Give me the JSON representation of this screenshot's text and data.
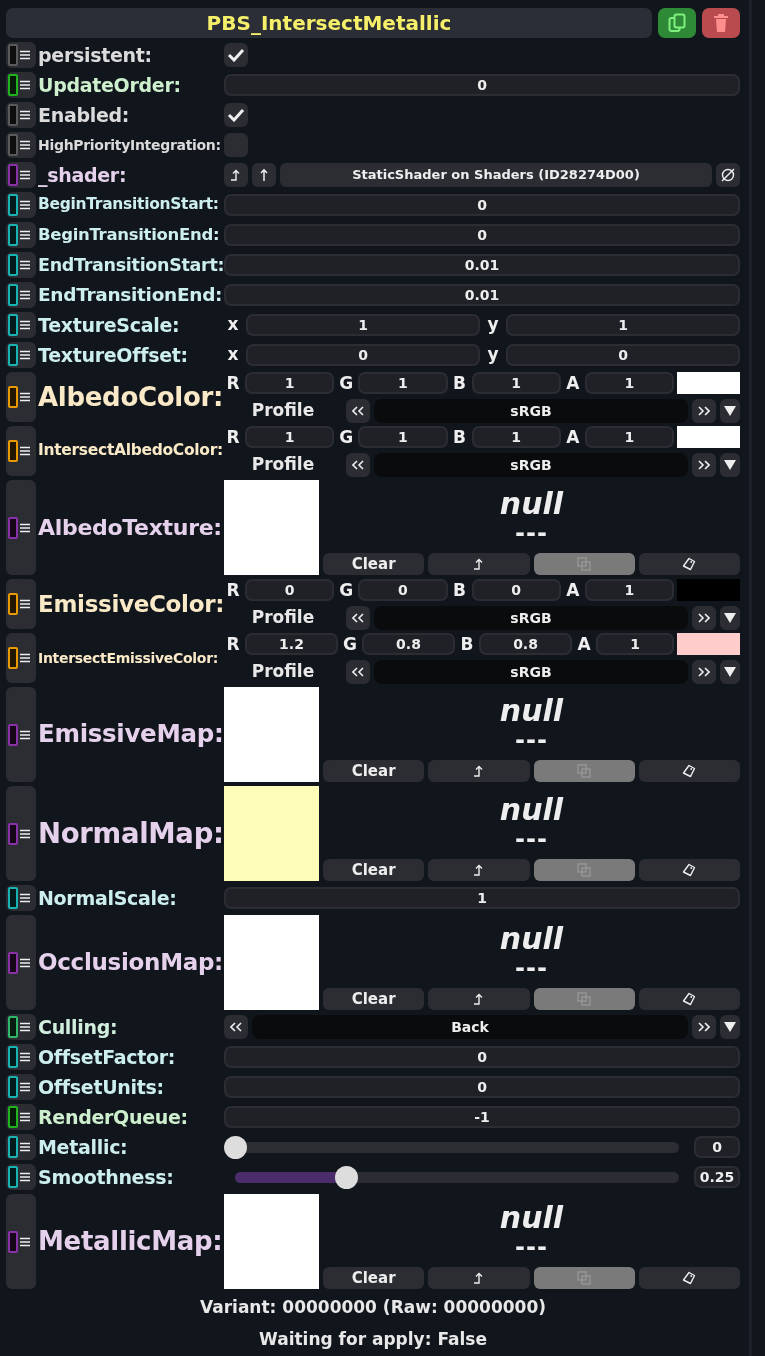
{
  "title": "PBS_IntersectMetallic",
  "fields": [
    {
      "kind": "checkbox",
      "label": "persistent:",
      "color": "#5a5a5a",
      "checked": true
    },
    {
      "kind": "number",
      "label": "UpdateOrder:",
      "color": "#1fb41f",
      "value": "0"
    },
    {
      "kind": "checkbox",
      "label": "Enabled:",
      "color": "#5a5a5a",
      "checked": true
    },
    {
      "kind": "checkbox",
      "label": "HighPriorityIntegration:",
      "color": "#5a5a5a",
      "checked": false
    },
    {
      "kind": "reference",
      "label": "_shader:",
      "color": "#8a30a8",
      "value": "StaticShader on Shaders (ID28274D00)"
    },
    {
      "kind": "number",
      "label": "BeginTransitionStart:",
      "color": "#19b3b3",
      "value": "0"
    },
    {
      "kind": "number",
      "label": "BeginTransitionEnd:",
      "color": "#19b3b3",
      "value": "0"
    },
    {
      "kind": "number",
      "label": "EndTransitionStart:",
      "color": "#19b3b3",
      "value": "0.01"
    },
    {
      "kind": "number",
      "label": "EndTransitionEnd:",
      "color": "#19b3b3",
      "value": "0.01"
    },
    {
      "kind": "vector",
      "label": "TextureScale:",
      "color": "#19b3b3",
      "components": [
        {
          "axis": "x",
          "value": "1"
        },
        {
          "axis": "y",
          "value": "1"
        }
      ]
    },
    {
      "kind": "vector",
      "label": "TextureOffset:",
      "color": "#19b3b3",
      "components": [
        {
          "axis": "x",
          "value": "0"
        },
        {
          "axis": "y",
          "value": "0"
        }
      ]
    },
    {
      "kind": "color",
      "label": "AlbedoColor:",
      "color": "#e89a00",
      "channels": [
        {
          "name": "R",
          "value": "1"
        },
        {
          "name": "G",
          "value": "1"
        },
        {
          "name": "B",
          "value": "1"
        },
        {
          "name": "A",
          "value": "1"
        }
      ],
      "swatch": {
        "color": "#ffffff"
      },
      "profile_label": "Profile",
      "profile": "sRGB"
    },
    {
      "kind": "color",
      "label": "IntersectAlbedoColor:",
      "color": "#e89a00",
      "channels": [
        {
          "name": "R",
          "value": "1"
        },
        {
          "name": "G",
          "value": "1"
        },
        {
          "name": "B",
          "value": "1"
        },
        {
          "name": "A",
          "value": "1"
        }
      ],
      "swatch": {
        "color": "#ffffff"
      },
      "profile_label": "Profile",
      "profile": "sRGB"
    },
    {
      "kind": "texture",
      "label": "AlbedoTexture:",
      "color": "#8a30a8",
      "preview": {
        "color": "#ffffff"
      },
      "value": "null",
      "detail": "---",
      "clear_label": "Clear",
      "copy_disabled": true
    },
    {
      "kind": "color",
      "label": "EmissiveColor:",
      "color": "#e89a00",
      "channels": [
        {
          "name": "R",
          "value": "0"
        },
        {
          "name": "G",
          "value": "0"
        },
        {
          "name": "B",
          "value": "0"
        },
        {
          "name": "A",
          "value": "1"
        }
      ],
      "swatch": {
        "color": "#000000"
      },
      "profile_label": "Profile",
      "profile": "sRGB"
    },
    {
      "kind": "color",
      "label": "IntersectEmissiveColor:",
      "color": "#e89a00",
      "channels": [
        {
          "name": "R",
          "value": "1.2"
        },
        {
          "name": "G",
          "value": "0.8"
        },
        {
          "name": "B",
          "value": "0.8"
        },
        {
          "name": "A",
          "value": "1"
        }
      ],
      "swatch": {
        "color": "#ffcccc"
      },
      "profile_label": "Profile",
      "profile": "sRGB"
    },
    {
      "kind": "texture",
      "label": "EmissiveMap:",
      "color": "#8a30a8",
      "preview": {
        "color": "#ffffff"
      },
      "value": "null",
      "detail": "---",
      "clear_label": "Clear",
      "copy_disabled": true
    },
    {
      "kind": "texture",
      "label": "NormalMap:",
      "color": "#8a30a8",
      "preview": {
        "color": "#fdfcb8"
      },
      "value": "null",
      "detail": "---",
      "clear_label": "Clear",
      "copy_disabled": true
    },
    {
      "kind": "number",
      "label": "NormalScale:",
      "color": "#19b3b3",
      "value": "1"
    },
    {
      "kind": "texture",
      "label": "OcclusionMap:",
      "color": "#8a30a8",
      "preview": {
        "color": "#ffffff"
      },
      "value": "null",
      "detail": "---",
      "clear_label": "Clear",
      "copy_disabled": true
    },
    {
      "kind": "enum",
      "label": "Culling:",
      "color": "#2fb86a",
      "value": "Back"
    },
    {
      "kind": "number",
      "label": "OffsetFactor:",
      "color": "#19b3b3",
      "value": "0"
    },
    {
      "kind": "number",
      "label": "OffsetUnits:",
      "color": "#19b3b3",
      "value": "0"
    },
    {
      "kind": "number",
      "label": "RenderQueue:",
      "color": "#1fb41f",
      "value": "-1"
    },
    {
      "kind": "slider",
      "label": "Metallic:",
      "color": "#19b3b3",
      "level": 0,
      "reading": "0"
    },
    {
      "kind": "slider",
      "label": "Smoothness:",
      "color": "#19b3b3",
      "level": 0.25,
      "reading": "0.25"
    },
    {
      "kind": "texture",
      "label": "MetallicMap:",
      "color": "#8a30a8",
      "preview": {
        "color": "#ffffff"
      },
      "value": "null",
      "detail": "---",
      "clear_label": "Clear",
      "copy_disabled": true
    }
  ],
  "footer": [
    "Variant: 00000000 (Raw: 00000000)",
    "Waiting for apply: False"
  ]
}
